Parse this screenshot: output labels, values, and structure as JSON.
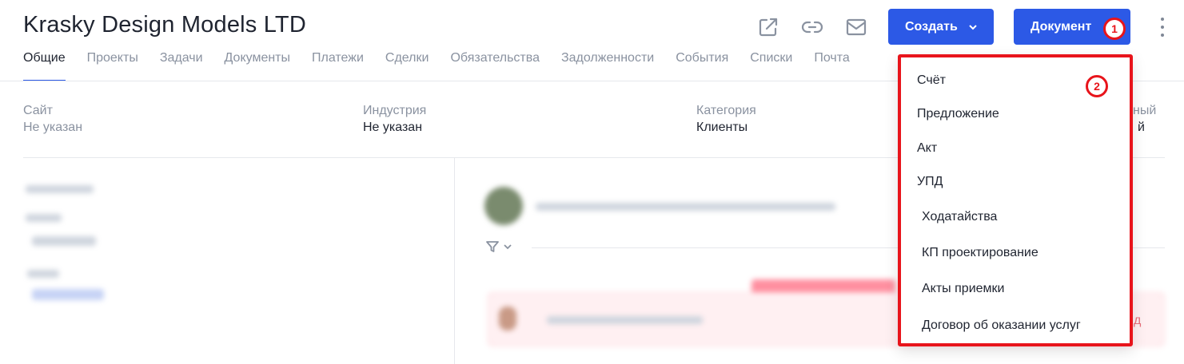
{
  "header": {
    "title": "Krasky Design Models LTD",
    "create_button": "Создать",
    "document_button": "Документ"
  },
  "tabs": [
    {
      "label": "Общие"
    },
    {
      "label": "Проекты"
    },
    {
      "label": "Задачи"
    },
    {
      "label": "Документы"
    },
    {
      "label": "Платежи"
    },
    {
      "label": "Сделки"
    },
    {
      "label": "Обязательства"
    },
    {
      "label": "Задолженности"
    },
    {
      "label": "События"
    },
    {
      "label": "Списки"
    },
    {
      "label": "Почта"
    }
  ],
  "info": {
    "site_label": "Сайт",
    "site_value": "Не указан",
    "industry_label": "Индустрия",
    "industry_value": "Не указан",
    "category_label": "Категория",
    "category_value": "Клиенты",
    "cutoff_label": "ный",
    "cutoff_value": "й"
  },
  "dropdown": {
    "items": [
      {
        "label": "Счёт"
      },
      {
        "label": "Предложение"
      },
      {
        "label": "Акт"
      },
      {
        "label": "УПД"
      },
      {
        "label": "Ходатайства"
      },
      {
        "label": "КП проектирование"
      },
      {
        "label": "Акты приемки"
      },
      {
        "label": "Договор об оказании услуг"
      }
    ]
  },
  "annotations": {
    "badge_1": "1",
    "badge_2": "2"
  },
  "feed": {
    "cutoff_link": "д"
  },
  "colors": {
    "primary": "#2c59e6",
    "annotation": "#e8141b",
    "muted_text": "#8a92a0"
  }
}
